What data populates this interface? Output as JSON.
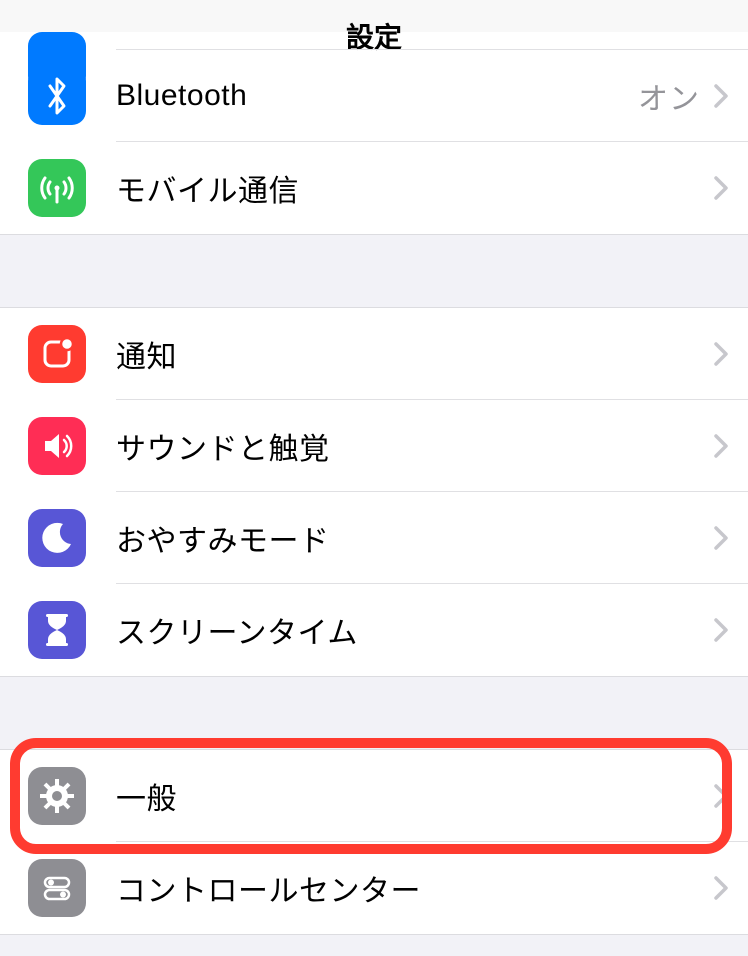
{
  "header": {
    "title": "設定"
  },
  "section1": {
    "items": [
      {
        "label": "Bluetooth",
        "detail": "オン"
      },
      {
        "label": "モバイル通信"
      }
    ]
  },
  "section2": {
    "items": [
      {
        "label": "通知"
      },
      {
        "label": "サウンドと触覚"
      },
      {
        "label": "おやすみモード"
      },
      {
        "label": "スクリーンタイム"
      }
    ]
  },
  "section3": {
    "items": [
      {
        "label": "一般"
      },
      {
        "label": "コントロールセンター"
      }
    ]
  },
  "highlight": {
    "target": "general-row"
  }
}
